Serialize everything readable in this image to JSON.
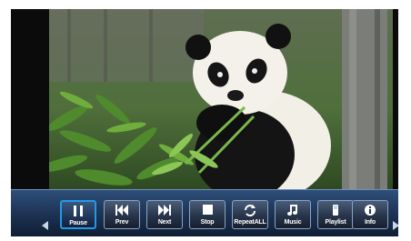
{
  "controls": [
    {
      "key": "pause",
      "label": "Pause",
      "icon": "pause-icon",
      "selected": true
    },
    {
      "key": "prev",
      "label": "Prev",
      "icon": "previous-icon",
      "selected": false
    },
    {
      "key": "next",
      "label": "Next",
      "icon": "next-icon",
      "selected": false
    },
    {
      "key": "stop",
      "label": "Stop",
      "icon": "stop-icon",
      "selected": false
    },
    {
      "key": "repeat",
      "label": "RepeatALL",
      "icon": "repeat-icon",
      "selected": false
    },
    {
      "key": "music",
      "label": "Music",
      "icon": "music-note-icon",
      "selected": false
    },
    {
      "key": "playlist",
      "label": "Playlist",
      "icon": "playlist-icon",
      "selected": false
    },
    {
      "key": "info",
      "label": "Info",
      "icon": "info-icon",
      "selected": false
    }
  ],
  "photo": {
    "subject": "giant panda eating bamboo"
  },
  "colors": {
    "selected_border": "#1e9be8",
    "bar": "#1f3658"
  }
}
